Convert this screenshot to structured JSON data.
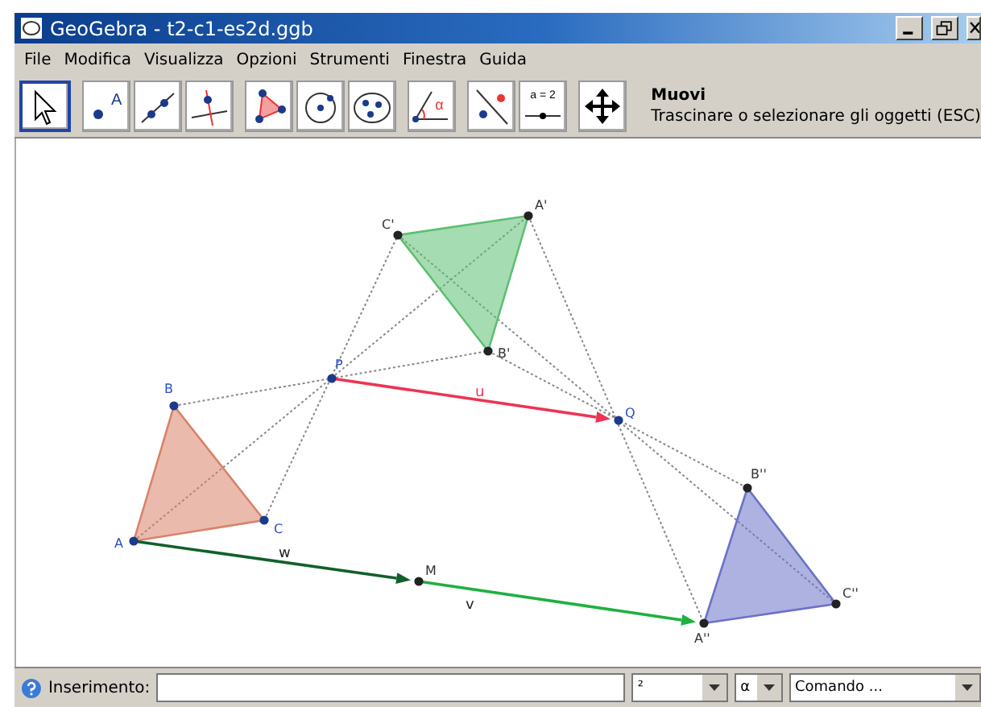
{
  "window": {
    "title": "GeoGebra - t2-c1-es2d.ggb"
  },
  "menu": [
    "File",
    "Modifica",
    "Visualizza",
    "Opzioni",
    "Strumenti",
    "Finestra",
    "Guida"
  ],
  "toolbar": {
    "tools": [
      {
        "kind": "move",
        "selected": true
      },
      {
        "kind": "point",
        "selected": false
      },
      {
        "kind": "line",
        "selected": false
      },
      {
        "kind": "perpendicular",
        "selected": false
      },
      {
        "kind": "polygon",
        "selected": false
      },
      {
        "kind": "circle",
        "selected": false
      },
      {
        "kind": "conic",
        "selected": false
      },
      {
        "kind": "angle",
        "selected": false
      },
      {
        "kind": "reflect",
        "selected": false
      },
      {
        "kind": "slider",
        "selected": false
      },
      {
        "kind": "pan",
        "selected": false
      }
    ],
    "slider_label": "a = 2",
    "point_label": "A",
    "angle_label": "α",
    "tool_name": "Muovi",
    "tool_hint": "Trascinare o selezionare gli oggetti (ESC)"
  },
  "canvas": {
    "triangles": [
      {
        "color": "#d9826a"
      },
      {
        "color": "#5cbf72"
      },
      {
        "color": "#6a72c8"
      }
    ],
    "points": [
      {
        "label": "A",
        "color": "#2b4fc0"
      },
      {
        "label": "B",
        "color": "#2b4fc0"
      },
      {
        "label": "C",
        "color": "#2b4fc0"
      },
      {
        "label": "P",
        "color": "#2b4fc0"
      },
      {
        "label": "C'",
        "color": "#333333"
      },
      {
        "label": "A'",
        "color": "#333333"
      },
      {
        "label": "B'",
        "color": "#333333"
      },
      {
        "label": "Q",
        "color": "#2b4fc0"
      },
      {
        "label": "B''",
        "color": "#333333"
      },
      {
        "label": "C''",
        "color": "#333333"
      },
      {
        "label": "A''",
        "color": "#333333"
      },
      {
        "label": "M",
        "color": "#333333"
      }
    ],
    "vectors": [
      {
        "label": "u",
        "color": "#ee3355"
      },
      {
        "label": "w",
        "color": "#11602a"
      },
      {
        "label": "v",
        "color": "#1fb040"
      }
    ]
  },
  "input_bar": {
    "label": "Inserimento:",
    "symbols": "²",
    "greek": "α",
    "command": "Comando ..."
  }
}
